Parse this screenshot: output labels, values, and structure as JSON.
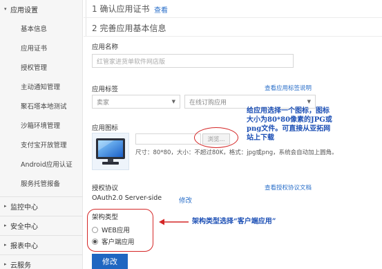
{
  "sidebar": {
    "sections": [
      {
        "label": "应用设置",
        "expanded": true
      },
      {
        "label": "监控中心",
        "expanded": false
      },
      {
        "label": "安全中心",
        "expanded": false
      },
      {
        "label": "报表中心",
        "expanded": false
      },
      {
        "label": "云服务",
        "expanded": false
      }
    ],
    "items": [
      {
        "label": "基本信息"
      },
      {
        "label": "应用证书"
      },
      {
        "label": "授权管理"
      },
      {
        "label": "主动通知管理"
      },
      {
        "label": "聚石塔本地测试"
      },
      {
        "label": "沙箱环境管理"
      },
      {
        "label": "支付宝开放管理"
      },
      {
        "label": "Android应用认证"
      },
      {
        "label": "服务托管报备"
      }
    ]
  },
  "steps": {
    "step1": {
      "title": "1 确认应用证书",
      "link": "查看"
    },
    "step2": {
      "title": "2 完善应用基本信息"
    }
  },
  "form": {
    "app_name": {
      "label": "应用名称",
      "placeholder": "红管家进货单软件网店版"
    },
    "app_tag": {
      "label": "应用标签",
      "help_link": "查看应用标签说明",
      "select1": "卖家",
      "select2": "在线订购应用"
    },
    "app_icon": {
      "label": "应用图标",
      "browse_label": "浏览...",
      "hint": "尺寸：80*80，大小：不超过80K，格式：jpg或png，系统会自动加上圆角。"
    },
    "auth": {
      "label": "授权协议",
      "help_link": "查看授权协议文档",
      "value": "OAuth2.0 Server-side",
      "edit_link": "修改"
    },
    "arch": {
      "label": "架构类型",
      "options": [
        {
          "label": "WEB应用",
          "checked": false
        },
        {
          "label": "客户端应用",
          "checked": true
        }
      ]
    },
    "submit_label": "修改"
  },
  "annotations": {
    "icon_note": [
      "给应用选择一个图标，图标",
      "大小为80*80像素的JPG或",
      "png文件。可直接从亚拓网",
      "站上下载"
    ],
    "arch_note": "架构类型选择“客户端应用”",
    "color": "#d42626",
    "text_color": "#1c4fb5"
  },
  "colors": {
    "accent": "#1f66c1",
    "link": "#2a6fc9"
  }
}
